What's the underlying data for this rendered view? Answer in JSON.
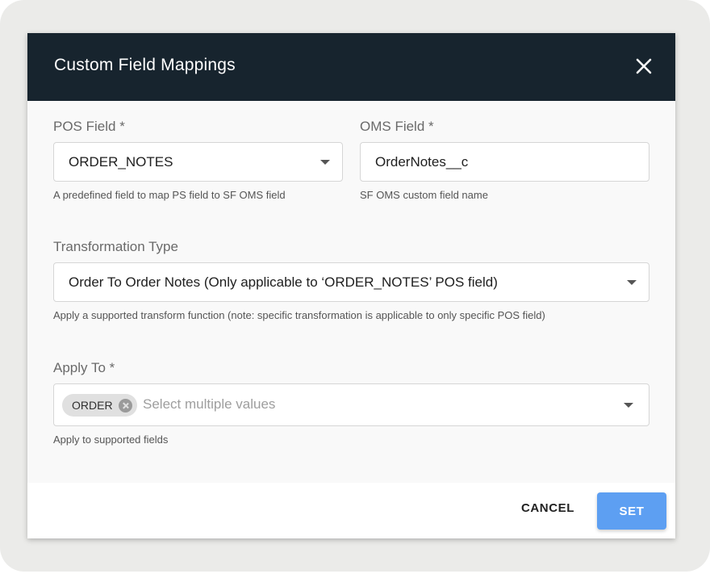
{
  "dialog": {
    "title": "Custom Field Mappings",
    "close_icon": "close-icon"
  },
  "pos_field": {
    "label": "POS Field *",
    "value": "ORDER_NOTES",
    "helper": "A predefined field to map PS field to SF OMS field"
  },
  "oms_field": {
    "label": "OMS Field *",
    "value": "OrderNotes__c",
    "helper": "SF OMS custom field name"
  },
  "transformation": {
    "label": "Transformation Type",
    "value": "Order To Order Notes (Only applicable to ‘ORDER_NOTES’ POS field)",
    "helper": "Apply a supported transform function (note: specific transformation is applicable to only specific POS field)"
  },
  "apply_to": {
    "label": "Apply To *",
    "chips": [
      "ORDER"
    ],
    "placeholder": "Select multiple values",
    "helper": "Apply to supported fields"
  },
  "footer": {
    "cancel_label": "CANCEL",
    "set_label": "SET"
  },
  "colors": {
    "header_bg": "#17242e",
    "primary_button": "#5d9ff2"
  }
}
